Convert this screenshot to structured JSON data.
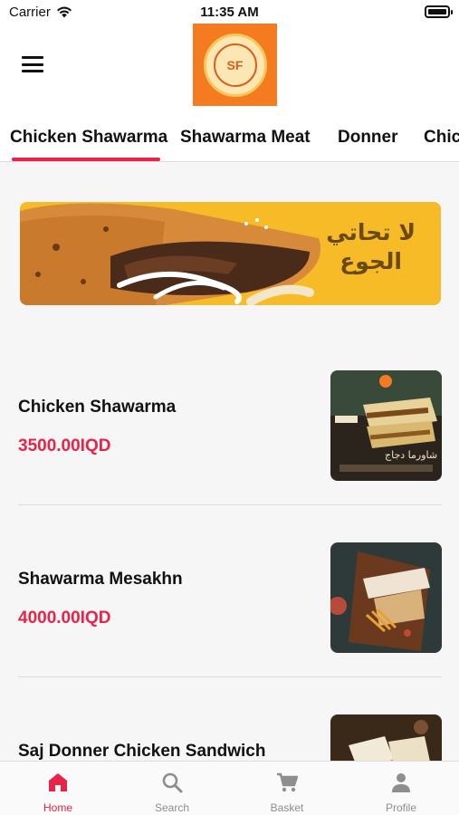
{
  "status_bar": {
    "carrier": "Carrier",
    "time": "11:35 AM"
  },
  "header": {
    "logo_text": "SF",
    "logo_alt": "SHAWARMA FACTORY"
  },
  "tabs": [
    {
      "label": "Chicken Shawarma",
      "active": true
    },
    {
      "label": "Shawarma Meat",
      "active": false
    },
    {
      "label": "Donner",
      "active": false
    },
    {
      "label": "Chic",
      "active": false
    }
  ],
  "banner": {
    "line1": "لا تحاتي",
    "line2": "الجوع"
  },
  "items": [
    {
      "name": "Chicken Shawarma",
      "price": "3500.00IQD"
    },
    {
      "name": "Shawarma Mesakhn",
      "price": "4000.00IQD"
    },
    {
      "name": "Saj Donner Chicken Sandwich",
      "price": ""
    }
  ],
  "bottom_nav": [
    {
      "label": "Home",
      "icon": "home-icon",
      "active": true
    },
    {
      "label": "Search",
      "icon": "search-icon",
      "active": false
    },
    {
      "label": "Basket",
      "icon": "cart-icon",
      "active": false
    },
    {
      "label": "Profile",
      "icon": "profile-icon",
      "active": false
    }
  ],
  "colors": {
    "accent": "#e8234a",
    "logo_bg": "#f47b20",
    "banner_bg": "#f8bb28"
  }
}
